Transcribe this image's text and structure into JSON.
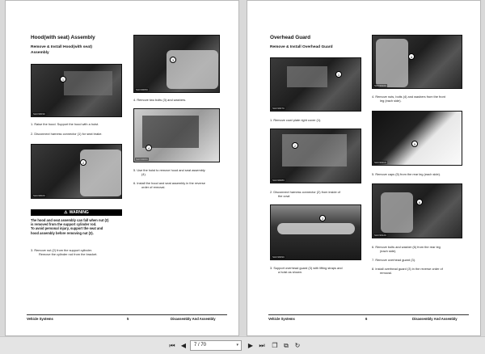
{
  "left_page": {
    "title": "Hood(with seat) Assembly",
    "subtitle_line1": "Remove & Install Hood(with seat)",
    "subtitle_line2": "Assembly",
    "photo1_caption": "SHC9903C",
    "photo2_caption": "SHC9902C",
    "photo3_caption": "SHC9905C",
    "photo4_caption": "SHC9906C",
    "step1": "1.   Raise the hood. Support the hood with a hoist.",
    "step2": "2.   Disconnect harness connector (1) for seat brake.",
    "warning_label": "WARNING",
    "warning_lines": [
      "The hood and seat assembly can fall when nut (2)",
      "is removed from the support cylinder rod.",
      "To avoid personal injury, support the seat and",
      "hood assembly before removing nut (2)."
    ],
    "step3_l1": "3.   Remove nut (2) from the support cylinder.",
    "step3_l2": "Remove the cylinder rod from the bracket.",
    "step4": "4.   Remove two bolts (3) and washers.",
    "step5_l1": "5.   Use the hoist to remove hood and seat assembly",
    "step5_l2": "(4).",
    "step6_l1": "6.   Install the hood and seat assembly in the reverse",
    "step6_l2": "order of removal.",
    "callouts": [
      "1",
      "2",
      "3",
      "4"
    ],
    "footer_left": "Vehicle Systems",
    "footer_page": "5",
    "footer_right": "Disassembly And Assembly"
  },
  "right_page": {
    "title": "Overhead Guard",
    "subtitle": "Remove & Install Overhead Guard",
    "photo1_caption": "SHC9907C",
    "photo2_caption": "SHC9908C",
    "photo3_caption": "SHC9909C",
    "photo4_caption": "SHC9910C",
    "photo5_caption": "SHC9911C",
    "photo6_caption": "SHC9912C",
    "step1": "1.   Remove cowl plate right cover (1).",
    "step2_l1": "2.   Disconnect harness connector (2) from inside of",
    "step2_l2": "the cowl.",
    "step3_l1": "3.   Support overhead guard (3) with lifting straps and",
    "step3_l2": "a hoist as shown.",
    "step4_l1": "4.   Remove nuts, bolts (4) and washers from the front",
    "step4_l2": "leg (each side).",
    "step5": "5.   Remove caps (5) from the rear leg (each side).",
    "step6_l1": "6.   Remove bolts and washer (6) from the rear leg",
    "step6_l2": "(each side).",
    "step7": "7.   Remove overhead guard (3).",
    "step8_l1": "8.   Install overhead guard (3) in the reverse order of",
    "step8_l2": "removal.",
    "callouts": [
      "1",
      "2",
      "3",
      "4",
      "5",
      "6"
    ],
    "footer_left": "Vehicle Systems",
    "footer_page": "6",
    "footer_right": "Disassembly And Assembly"
  },
  "toolbar": {
    "first_icon": "first-page-icon",
    "prev_icon": "previous-page-icon",
    "page_value": "7 / 70",
    "next_icon": "next-page-icon",
    "last_icon": "last-page-icon",
    "copy_icon": "copy-icon",
    "fit_icon": "fit-page-icon",
    "rotate_icon": "rotate-icon",
    "glyph_first": "⏮",
    "glyph_prev": "◀",
    "glyph_next": "▶",
    "glyph_last": "⏭",
    "glyph_copy": "❐",
    "glyph_fit": "⧉",
    "glyph_rotate": "↻",
    "glyph_caret": "▾"
  }
}
